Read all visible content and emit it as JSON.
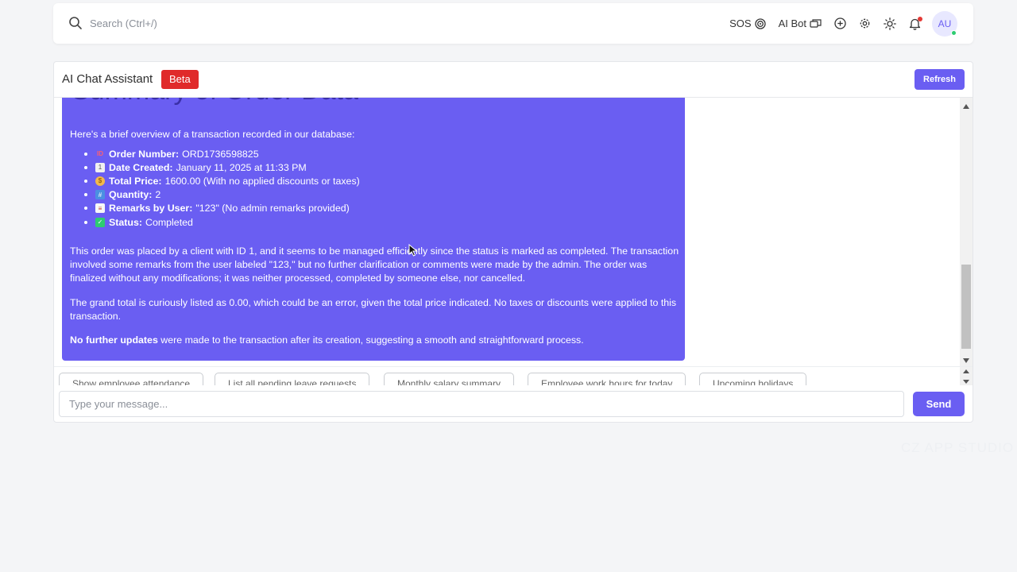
{
  "topbar": {
    "search_placeholder": "Search (Ctrl+/)",
    "sos_label": "SOS",
    "ai_bot_label": "AI Bot",
    "avatar_initials": "AU"
  },
  "chat": {
    "title": "AI Chat Assistant",
    "badge": "Beta",
    "refresh_label": "Refresh",
    "message": {
      "heading": "Summary of Order Data",
      "intro": "Here's a brief overview of a transaction recorded in our database:",
      "details": [
        {
          "icon": "id-icon",
          "label": "Order Number:",
          "value": "ORD1736598825"
        },
        {
          "icon": "calendar-icon",
          "label": "Date Created:",
          "value": "January 11, 2025 at 11:33 PM"
        },
        {
          "icon": "money-bag-icon",
          "label": "Total Price:",
          "value": "1600.00 (With no applied discounts or taxes)"
        },
        {
          "icon": "quantity-icon",
          "label": "Quantity:",
          "value": "2"
        },
        {
          "icon": "memo-icon",
          "label": "Remarks by User:",
          "value": "\"123\" (No admin remarks provided)"
        },
        {
          "icon": "check-icon",
          "label": "Status:",
          "value": "Completed"
        }
      ],
      "para1": "This order was placed by a client with ID 1, and it seems to be managed efficiently since the status is marked as completed. The transaction involved some remarks from the user labeled \"123,\" but no further clarification or comments were made by the admin. The order was finalized without any modifications; it was neither processed, completed by someone else, nor cancelled.",
      "para2": "The grand total is curiously listed as 0.00, which could be an error, given the total price indicated. No taxes or discounts were applied to this transaction.",
      "para3_bold": "No further updates",
      "para3_rest": " were made to the transaction after its creation, suggesting a smooth and straightforward process."
    },
    "suggestions": [
      "Show employee attendance",
      "List all pending leave requests",
      "Monthly salary summary",
      "Employee work hours for today",
      "Upcoming holidays"
    ],
    "input_placeholder": "Type your message...",
    "send_label": "Send"
  },
  "watermark": "CZ APP STUDIO",
  "colors": {
    "accent": "#6a5ef2",
    "badge": "#e02a2a",
    "online": "#2ecc71"
  }
}
